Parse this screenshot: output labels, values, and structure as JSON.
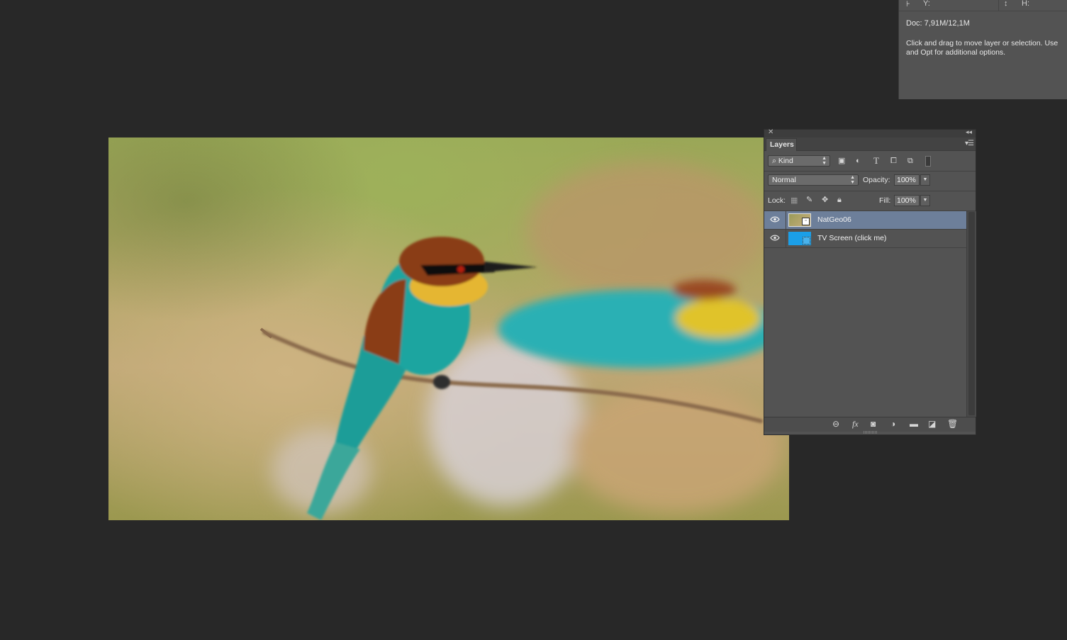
{
  "info_panel": {
    "y_label": "Y:",
    "h_label": "H:",
    "doc_size": "Doc: 7,91M/12,1M",
    "hint": "Click and drag to move layer or selection.  Use\nand Opt for additional options."
  },
  "canvas": {
    "image_description_colors": {
      "bg_green": "#9aa757",
      "bg_tan": "#cdb381",
      "bird_teal": "#1fa5a0",
      "bird_yellow": "#e5b630",
      "bird_rust": "#8a3c14"
    }
  },
  "layers_panel": {
    "tab_label": "Layers",
    "filter": {
      "label": "Kind",
      "icons": [
        "image-filter-icon",
        "adjustment-filter-icon",
        "type-filter-icon",
        "shape-filter-icon",
        "smart-object-filter-icon",
        "filter-toggle"
      ]
    },
    "blend_mode": "Normal",
    "opacity_label": "Opacity:",
    "opacity_value": "100%",
    "lock_label": "Lock:",
    "fill_label": "Fill:",
    "fill_value": "100%",
    "layers": [
      {
        "name": "NatGeo06",
        "active": true,
        "visible": true,
        "thumb_color": "#9a9a58"
      },
      {
        "name": "TV Screen (click me)",
        "active": false,
        "visible": true,
        "thumb_color": "#1b9fe8"
      }
    ],
    "bottom_icons": [
      "link-layers-icon",
      "fx-icon",
      "add-mask-icon",
      "adjustment-layer-icon",
      "new-group-icon",
      "new-layer-icon",
      "delete-layer-icon"
    ]
  },
  "colors": {
    "workspace_bg": "#282828",
    "panel_bg": "#535353",
    "active_layer": "#6d7f9a"
  }
}
